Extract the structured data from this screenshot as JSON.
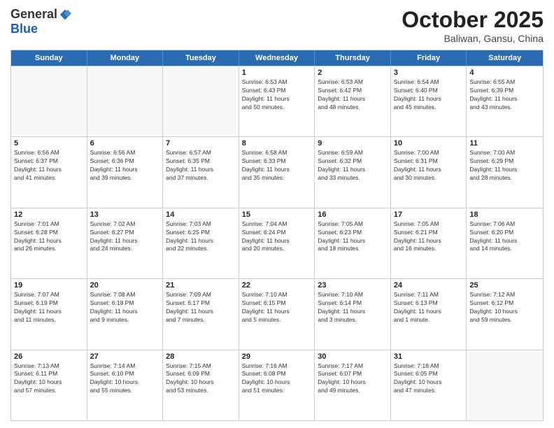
{
  "logo": {
    "general": "General",
    "blue": "Blue"
  },
  "header": {
    "month": "October 2025",
    "location": "Baliwan, Gansu, China"
  },
  "weekdays": [
    "Sunday",
    "Monday",
    "Tuesday",
    "Wednesday",
    "Thursday",
    "Friday",
    "Saturday"
  ],
  "weeks": [
    [
      {
        "day": "",
        "text": ""
      },
      {
        "day": "",
        "text": ""
      },
      {
        "day": "",
        "text": ""
      },
      {
        "day": "1",
        "text": "Sunrise: 6:53 AM\nSunset: 6:43 PM\nDaylight: 11 hours\nand 50 minutes."
      },
      {
        "day": "2",
        "text": "Sunrise: 6:53 AM\nSunset: 6:42 PM\nDaylight: 11 hours\nand 48 minutes."
      },
      {
        "day": "3",
        "text": "Sunrise: 6:54 AM\nSunset: 6:40 PM\nDaylight: 11 hours\nand 45 minutes."
      },
      {
        "day": "4",
        "text": "Sunrise: 6:55 AM\nSunset: 6:39 PM\nDaylight: 11 hours\nand 43 minutes."
      }
    ],
    [
      {
        "day": "5",
        "text": "Sunrise: 6:56 AM\nSunset: 6:37 PM\nDaylight: 11 hours\nand 41 minutes."
      },
      {
        "day": "6",
        "text": "Sunrise: 6:56 AM\nSunset: 6:36 PM\nDaylight: 11 hours\nand 39 minutes."
      },
      {
        "day": "7",
        "text": "Sunrise: 6:57 AM\nSunset: 6:35 PM\nDaylight: 11 hours\nand 37 minutes."
      },
      {
        "day": "8",
        "text": "Sunrise: 6:58 AM\nSunset: 6:33 PM\nDaylight: 11 hours\nand 35 minutes."
      },
      {
        "day": "9",
        "text": "Sunrise: 6:59 AM\nSunset: 6:32 PM\nDaylight: 11 hours\nand 33 minutes."
      },
      {
        "day": "10",
        "text": "Sunrise: 7:00 AM\nSunset: 6:31 PM\nDaylight: 11 hours\nand 30 minutes."
      },
      {
        "day": "11",
        "text": "Sunrise: 7:00 AM\nSunset: 6:29 PM\nDaylight: 11 hours\nand 28 minutes."
      }
    ],
    [
      {
        "day": "12",
        "text": "Sunrise: 7:01 AM\nSunset: 6:28 PM\nDaylight: 11 hours\nand 26 minutes."
      },
      {
        "day": "13",
        "text": "Sunrise: 7:02 AM\nSunset: 6:27 PM\nDaylight: 11 hours\nand 24 minutes."
      },
      {
        "day": "14",
        "text": "Sunrise: 7:03 AM\nSunset: 6:25 PM\nDaylight: 11 hours\nand 22 minutes."
      },
      {
        "day": "15",
        "text": "Sunrise: 7:04 AM\nSunset: 6:24 PM\nDaylight: 11 hours\nand 20 minutes."
      },
      {
        "day": "16",
        "text": "Sunrise: 7:05 AM\nSunset: 6:23 PM\nDaylight: 11 hours\nand 18 minutes."
      },
      {
        "day": "17",
        "text": "Sunrise: 7:05 AM\nSunset: 6:21 PM\nDaylight: 11 hours\nand 16 minutes."
      },
      {
        "day": "18",
        "text": "Sunrise: 7:06 AM\nSunset: 6:20 PM\nDaylight: 11 hours\nand 14 minutes."
      }
    ],
    [
      {
        "day": "19",
        "text": "Sunrise: 7:07 AM\nSunset: 6:19 PM\nDaylight: 11 hours\nand 11 minutes."
      },
      {
        "day": "20",
        "text": "Sunrise: 7:08 AM\nSunset: 6:18 PM\nDaylight: 11 hours\nand 9 minutes."
      },
      {
        "day": "21",
        "text": "Sunrise: 7:09 AM\nSunset: 6:17 PM\nDaylight: 11 hours\nand 7 minutes."
      },
      {
        "day": "22",
        "text": "Sunrise: 7:10 AM\nSunset: 6:15 PM\nDaylight: 11 hours\nand 5 minutes."
      },
      {
        "day": "23",
        "text": "Sunrise: 7:10 AM\nSunset: 6:14 PM\nDaylight: 11 hours\nand 3 minutes."
      },
      {
        "day": "24",
        "text": "Sunrise: 7:11 AM\nSunset: 6:13 PM\nDaylight: 11 hours\nand 1 minute."
      },
      {
        "day": "25",
        "text": "Sunrise: 7:12 AM\nSunset: 6:12 PM\nDaylight: 10 hours\nand 59 minutes."
      }
    ],
    [
      {
        "day": "26",
        "text": "Sunrise: 7:13 AM\nSunset: 6:11 PM\nDaylight: 10 hours\nand 57 minutes."
      },
      {
        "day": "27",
        "text": "Sunrise: 7:14 AM\nSunset: 6:10 PM\nDaylight: 10 hours\nand 55 minutes."
      },
      {
        "day": "28",
        "text": "Sunrise: 7:15 AM\nSunset: 6:09 PM\nDaylight: 10 hours\nand 53 minutes."
      },
      {
        "day": "29",
        "text": "Sunrise: 7:16 AM\nSunset: 6:08 PM\nDaylight: 10 hours\nand 51 minutes."
      },
      {
        "day": "30",
        "text": "Sunrise: 7:17 AM\nSunset: 6:07 PM\nDaylight: 10 hours\nand 49 minutes."
      },
      {
        "day": "31",
        "text": "Sunrise: 7:18 AM\nSunset: 6:05 PM\nDaylight: 10 hours\nand 47 minutes."
      },
      {
        "day": "",
        "text": ""
      }
    ]
  ]
}
